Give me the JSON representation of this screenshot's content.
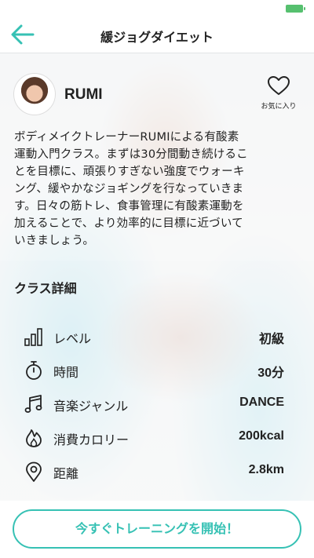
{
  "colors": {
    "accent": "#36c1b4",
    "battery": "#56c06f"
  },
  "header": {
    "title": "緩ジョグダイエット",
    "back_icon": "arrow-left-icon"
  },
  "coach": {
    "name": "RUMI",
    "favorite_label": "お気に入り",
    "favorite_icon": "heart-outline-icon"
  },
  "description": {
    "lines": [
      "ボディメイクトレーナーRUMIによる有酸素",
      "運動入門クラス。まずは30分間動き続けるこ",
      "とを目標に、頑張りすぎない強度でウォーキ",
      "ング、緩やかなジョギングを行なっていきま",
      "す。日々の筋トレ、食事管理に有酸素運動を",
      "加えることで、より効率的に目標に近づいて",
      "いきましょう。"
    ]
  },
  "details": {
    "title": "クラス詳細",
    "rows": [
      {
        "icon": "level-bars-icon",
        "label": "レベル",
        "value": "初級"
      },
      {
        "icon": "stopwatch-icon",
        "label": "時間",
        "value": "30分"
      },
      {
        "icon": "music-note-icon",
        "label": "音楽ジャンル",
        "value": "DANCE"
      },
      {
        "icon": "flame-icon",
        "label": "消費カロリー",
        "value": "200kcal"
      },
      {
        "icon": "location-pin-icon",
        "label": "距離",
        "value": "2.8km"
      }
    ]
  },
  "cta": {
    "label": "今すぐトレーニングを開始！"
  }
}
